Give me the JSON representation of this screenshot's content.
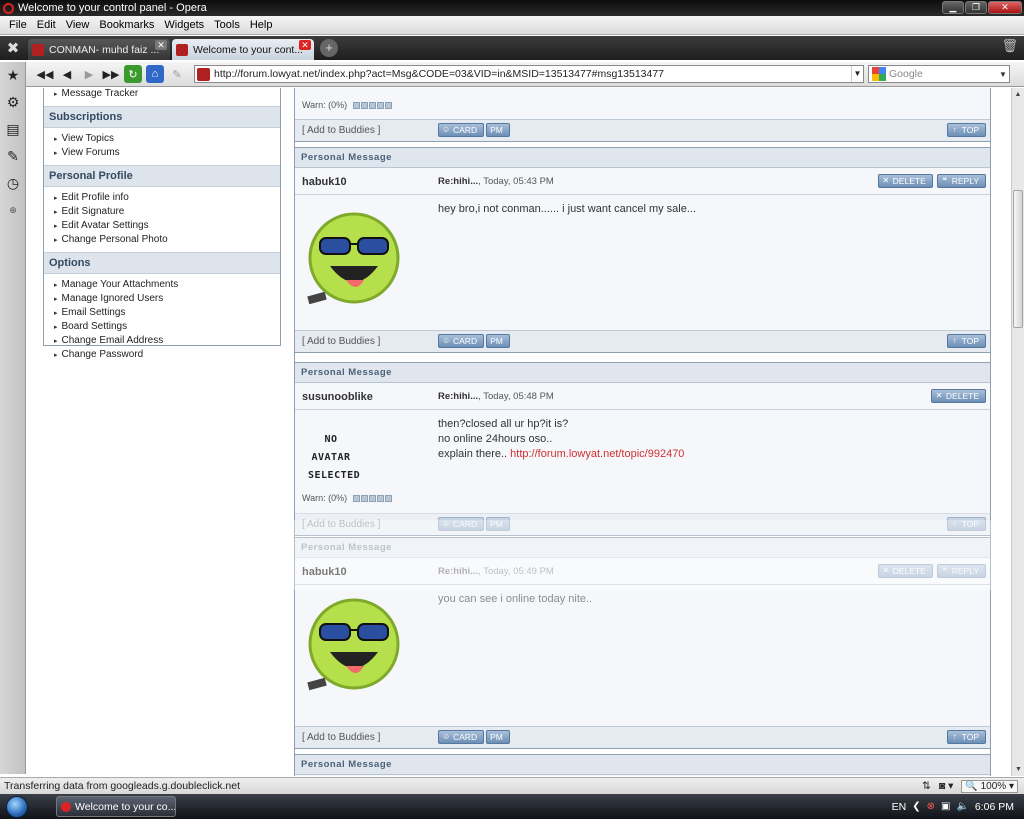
{
  "window": {
    "title": "Welcome to your control panel - Opera",
    "buttons": {
      "minimize": "▁",
      "maximize": "❐",
      "close": "✕"
    }
  },
  "menu": [
    "File",
    "Edit",
    "View",
    "Bookmarks",
    "Widgets",
    "Tools",
    "Help"
  ],
  "tabs": [
    {
      "label": "CONMAN- muhd faiz ...",
      "active": false
    },
    {
      "label": "Welcome to your cont...",
      "active": true
    }
  ],
  "address": {
    "url": "http://forum.lowyat.net/index.php?act=Msg&CODE=03&VID=in&MSID=13513477#msg13513477",
    "search_placeholder": "Google"
  },
  "sidebar": {
    "top_items": [
      "Message Tracker"
    ],
    "sections": [
      {
        "title": "Subscriptions",
        "items": [
          "View Topics",
          "View Forums"
        ]
      },
      {
        "title": "Personal Profile",
        "items": [
          "Edit Profile info",
          "Edit Signature",
          "Edit Avatar Settings",
          "Change Personal Photo"
        ]
      },
      {
        "title": "Options",
        "items": [
          "Manage Your Attachments",
          "Manage Ignored Users",
          "Email Settings",
          "Board Settings",
          "Change Email Address",
          "Change Password"
        ]
      }
    ]
  },
  "labels": {
    "pm_header": "Personal Message",
    "warn": "Warn: (0%)",
    "add_buddies": "[ Add to Buddies ]",
    "card": "CARD",
    "pm": "PM",
    "top": "TOP",
    "delete": "DELETE",
    "reply": "REPLY",
    "no_avatar_1": "NO AVATAR",
    "no_avatar_2": "SELECTED"
  },
  "messages": [
    {
      "user": "habuk10",
      "subject": "Re:hihi...",
      "time": ", Today, 05:43 PM",
      "body": [
        "hey bro,i not conman...... i just want cancel my sale..."
      ]
    },
    {
      "user": "susunooblike",
      "subject": "Re:hihi...",
      "time": ", Today, 05:48 PM",
      "body": [
        "then?closed all ur hp?it is?",
        "no online 24hours oso..",
        "explain there.. "
      ],
      "link": "http://forum.lowyat.net/topic/992470"
    },
    {
      "user": "habuk10",
      "subject": "Re:hihi...",
      "time": ", Today, 05:49 PM",
      "body": [
        "you can see i online today nite.."
      ]
    }
  ],
  "status": {
    "text": "Transferring data from googleads.g.doubleclick.net",
    "zoom": "100%"
  },
  "taskbar": {
    "task": "Welcome to your co...",
    "lang": "EN",
    "clock": "6:06 PM"
  },
  "colors": {
    "accent": "#6d8fb6",
    "link": "#d03030",
    "header_bg": "#dfe6ee"
  }
}
